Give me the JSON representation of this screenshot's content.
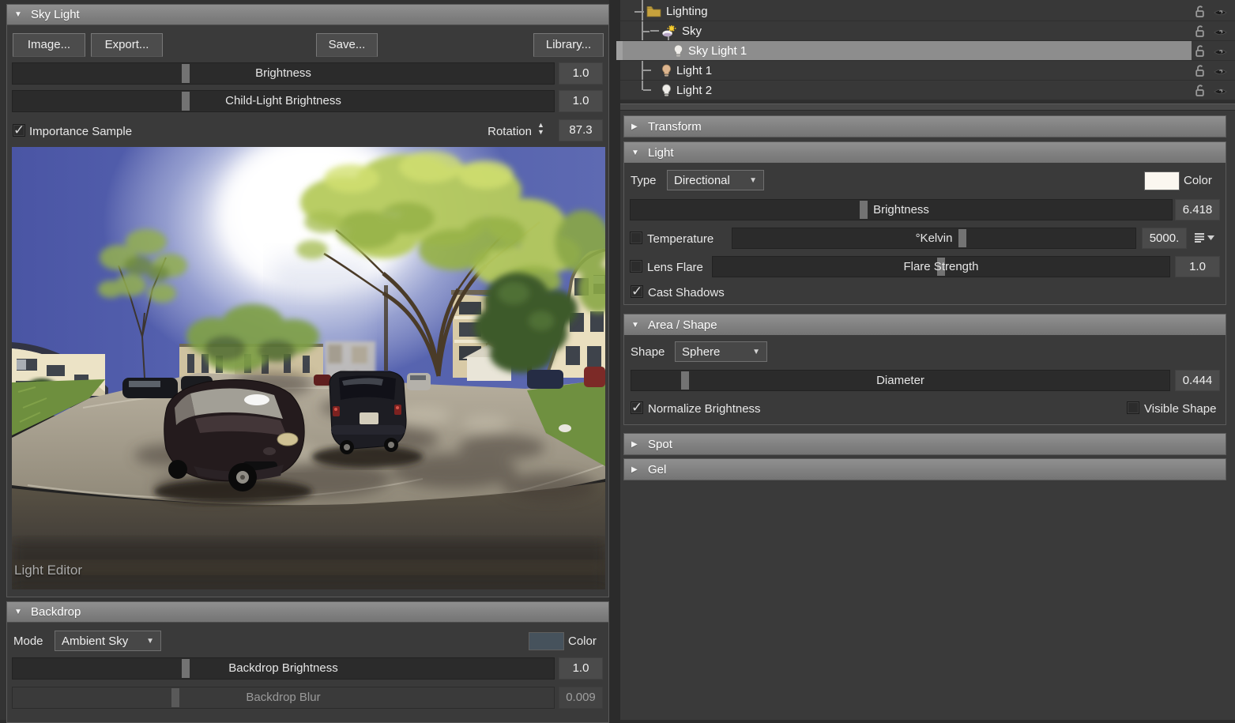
{
  "icons": {
    "expanded": "▼",
    "collapsed": "▶",
    "dropdown": "▼",
    "spinner_up": "▲",
    "spinner_down": "▼",
    "checkmark": "✓"
  },
  "colors": {
    "light_color": "#fbf7f0",
    "backdrop_color": "#46525c"
  },
  "sky_light": {
    "title": "Sky Light",
    "image_button": "Image...",
    "export_button": "Export...",
    "save_button": "Save...",
    "library_button": "Library...",
    "brightness": {
      "label": "Brightness",
      "value": "1.0",
      "pct": 32
    },
    "child_brightness": {
      "label": "Child-Light Brightness",
      "value": "1.0",
      "pct": 32
    },
    "importance_sample": {
      "label": "Importance Sample",
      "checked": true
    },
    "rotation": {
      "label": "Rotation",
      "value": "87.3"
    },
    "caption": "Light Editor"
  },
  "backdrop": {
    "title": "Backdrop",
    "mode_label": "Mode",
    "mode_value": "Ambient Sky",
    "color_label": "Color",
    "brightness": {
      "label": "Backdrop Brightness",
      "value": "1.0",
      "pct": 32
    },
    "blur": {
      "label": "Backdrop Blur",
      "value": "0.009",
      "pct": 30,
      "enabled": false
    }
  },
  "tree": {
    "items": [
      {
        "label": "Lighting",
        "icon": "folder-icon",
        "selected": false,
        "locked": false,
        "visible": true
      },
      {
        "label": "Sky",
        "icon": "sky-icon",
        "selected": false,
        "locked": false,
        "visible": true
      },
      {
        "label": "Sky Light 1",
        "icon": "light-bulb-icon",
        "selected": true,
        "locked": false,
        "visible": true
      },
      {
        "label": "Light 1",
        "icon": "light-bulb-icon",
        "selected": false,
        "locked": false,
        "visible": true
      },
      {
        "label": "Light 2",
        "icon": "light-bulb-icon",
        "selected": false,
        "locked": false,
        "visible": true
      }
    ]
  },
  "properties": {
    "transform": {
      "title": "Transform"
    },
    "light": {
      "title": "Light",
      "type_label": "Type",
      "type_value": "Directional",
      "color_label": "Color",
      "brightness": {
        "label": "Brightness",
        "value": "6.418",
        "pct": 43
      },
      "temperature": {
        "label": "Temperature",
        "checked": false,
        "slider_label": "°Kelvin",
        "value": "5000.",
        "pct": 57
      },
      "lens_flare": {
        "label": "Lens Flare",
        "checked": false,
        "slider_label": "Flare Strength",
        "value": "1.0",
        "pct": 50
      },
      "cast_shadows": {
        "label": "Cast Shadows",
        "checked": true
      }
    },
    "area_shape": {
      "title": "Area / Shape",
      "shape_label": "Shape",
      "shape_value": "Sphere",
      "diameter": {
        "label": "Diameter",
        "value": "0.444",
        "pct": 10
      },
      "normalize": {
        "label": "Normalize Brightness",
        "checked": true
      },
      "visible_shape": {
        "label": "Visible Shape",
        "checked": false
      }
    },
    "spot": {
      "title": "Spot"
    },
    "gel": {
      "title": "Gel"
    }
  }
}
